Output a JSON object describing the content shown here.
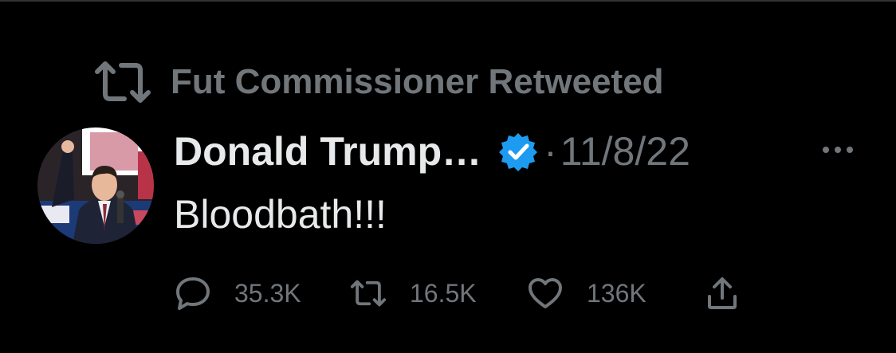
{
  "retweet_context": {
    "label": "Fut Commissioner Retweeted",
    "icon": "retweet-icon"
  },
  "tweet": {
    "display_name": "Donald Trump…",
    "verified": true,
    "separator": "·",
    "date": "11/8/22",
    "text": "Bloodbath!!!",
    "more_icon": "more-horizontal-icon"
  },
  "actions": {
    "reply": {
      "icon": "reply-icon",
      "count": "35.3K"
    },
    "retweet": {
      "icon": "retweet-icon",
      "count": "16.5K"
    },
    "like": {
      "icon": "heart-icon",
      "count": "136K"
    },
    "share": {
      "icon": "share-icon"
    }
  },
  "colors": {
    "background": "#000000",
    "primary_text": "#e7e9ea",
    "secondary_text": "#71767b",
    "verified_blue": "#1d9bf0",
    "divider": "#2f3336"
  }
}
